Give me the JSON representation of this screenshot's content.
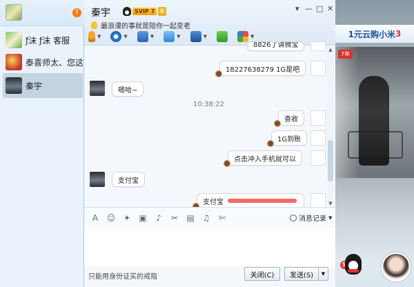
{
  "sidebar": {
    "notification_count": "!",
    "contacts": [
      {
        "name": "ƒ沫 ƒ沫 客服"
      },
      {
        "name": "泰喜师太、您这边"
      },
      {
        "name": "秦宇"
      }
    ]
  },
  "header": {
    "name": "秦宇",
    "vip_badge": "SVIP 7",
    "vip_year": "年",
    "signature": "最浪漫的事就是陪你一起变老",
    "window_controls": {
      "dropdown": "▾",
      "minimize": "—",
      "maximize": "□",
      "close": "✕"
    }
  },
  "chat": {
    "messages": [
      {
        "side": "right",
        "text": "8826了请微宝"
      },
      {
        "side": "right",
        "text": "18227638279   1G是吧"
      },
      {
        "side": "left",
        "text": "嗯哈~"
      },
      {
        "side": "right",
        "text": "查收"
      },
      {
        "side": "right",
        "text": "1G到账"
      },
      {
        "side": "right",
        "text": "点击冲入手机就可以"
      },
      {
        "side": "left",
        "text": "支付宝"
      },
      {
        "side": "right",
        "text": "支付宝"
      }
    ],
    "timestamp": "10:38:22"
  },
  "input": {
    "history_label": "消息记录",
    "hint": "只能用身份证买的戒指",
    "close_label": "关闭(C)",
    "send_label": "发送(S)"
  },
  "ad": {
    "banner_prefix": "1元云购小米",
    "banner_suffix": "3",
    "tag": "7年"
  },
  "colors": {
    "accent": "#2f86d8",
    "notification": "#f07d19",
    "redaction": "#f05a55"
  }
}
